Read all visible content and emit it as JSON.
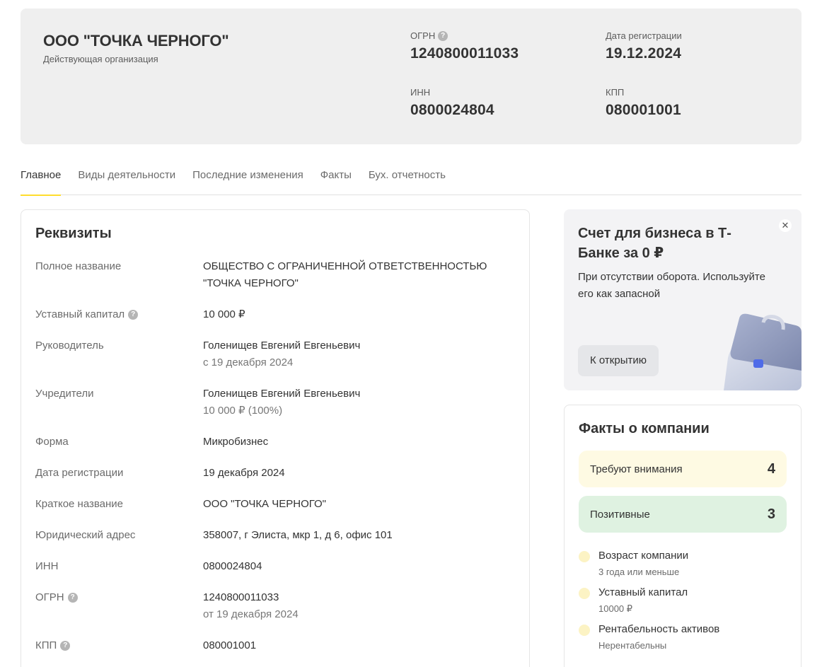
{
  "header": {
    "company_name": "ООО \"ТОЧКА ЧЕРНОГО\"",
    "status": "Действующая организация",
    "ogrn_label": "ОГРН",
    "ogrn_value": "1240800011033",
    "reg_date_label": "Дата регистрации",
    "reg_date_value": "19.12.2024",
    "inn_label": "ИНН",
    "inn_value": "0800024804",
    "kpp_label": "КПП",
    "kpp_value": "080001001"
  },
  "tabs": [
    {
      "label": "Главное",
      "active": true
    },
    {
      "label": "Виды деятельности",
      "active": false
    },
    {
      "label": "Последние изменения",
      "active": false
    },
    {
      "label": "Факты",
      "active": false
    },
    {
      "label": "Бух. отчетность",
      "active": false
    }
  ],
  "requisites": {
    "title": "Реквизиты",
    "full_name_label": "Полное название",
    "full_name_value": "ОБЩЕСТВО С ОГРАНИЧЕННОЙ ОТВЕТСТВЕННОСТЬЮ \"ТОЧКА ЧЕРНОГО\"",
    "capital_label": "Уставный капитал",
    "capital_value": "10 000 ₽",
    "head_label": "Руководитель",
    "head_value": "Голенищев Евгений Евгеньевич",
    "head_since": "с 19 декабря 2024",
    "founders_label": "Учредители",
    "founders_value": "Голенищев Евгений Евгеньевич",
    "founders_share": "10 000 ₽ (100%)",
    "form_label": "Форма",
    "form_value": "Микробизнес",
    "reg_date_label": "Дата регистрации",
    "reg_date_value": "19 декабря 2024",
    "short_name_label": "Краткое название",
    "short_name_value": "ООО \"ТОЧКА ЧЕРНОГО\"",
    "address_label": "Юридический адрес",
    "address_value": "358007, г Элиста, мкр 1, д 6, офис 101",
    "inn_label": "ИНН",
    "inn_value": "0800024804",
    "ogrn_label": "ОГРН",
    "ogrn_value": "1240800011033",
    "ogrn_date": "от 19 декабря 2024",
    "kpp_label": "КПП",
    "kpp_value": "080001001"
  },
  "promo": {
    "title": "Счет для бизнеса в Т-Банке за 0 ₽",
    "text": "При отсутствии оборота. Используйте его как запасной",
    "button_label": "К открытию",
    "close_glyph": "✕"
  },
  "facts": {
    "title": "Факты о компании",
    "attention_label": "Требуют внимания",
    "attention_count": "4",
    "positive_label": "Позитивные",
    "positive_count": "3",
    "items": [
      {
        "title": "Возраст компании",
        "sub": "3 года или меньше"
      },
      {
        "title": "Уставный капитал",
        "sub": "10000 ₽"
      },
      {
        "title": "Рентабельность активов",
        "sub": "Нерентабельны"
      }
    ]
  },
  "colors": {
    "accent_yellow": "#ffdd2d",
    "attention_bg": "#fefae3",
    "positive_bg": "#dff2e1",
    "header_bg": "#efefef"
  },
  "icons": {
    "help": "?"
  }
}
